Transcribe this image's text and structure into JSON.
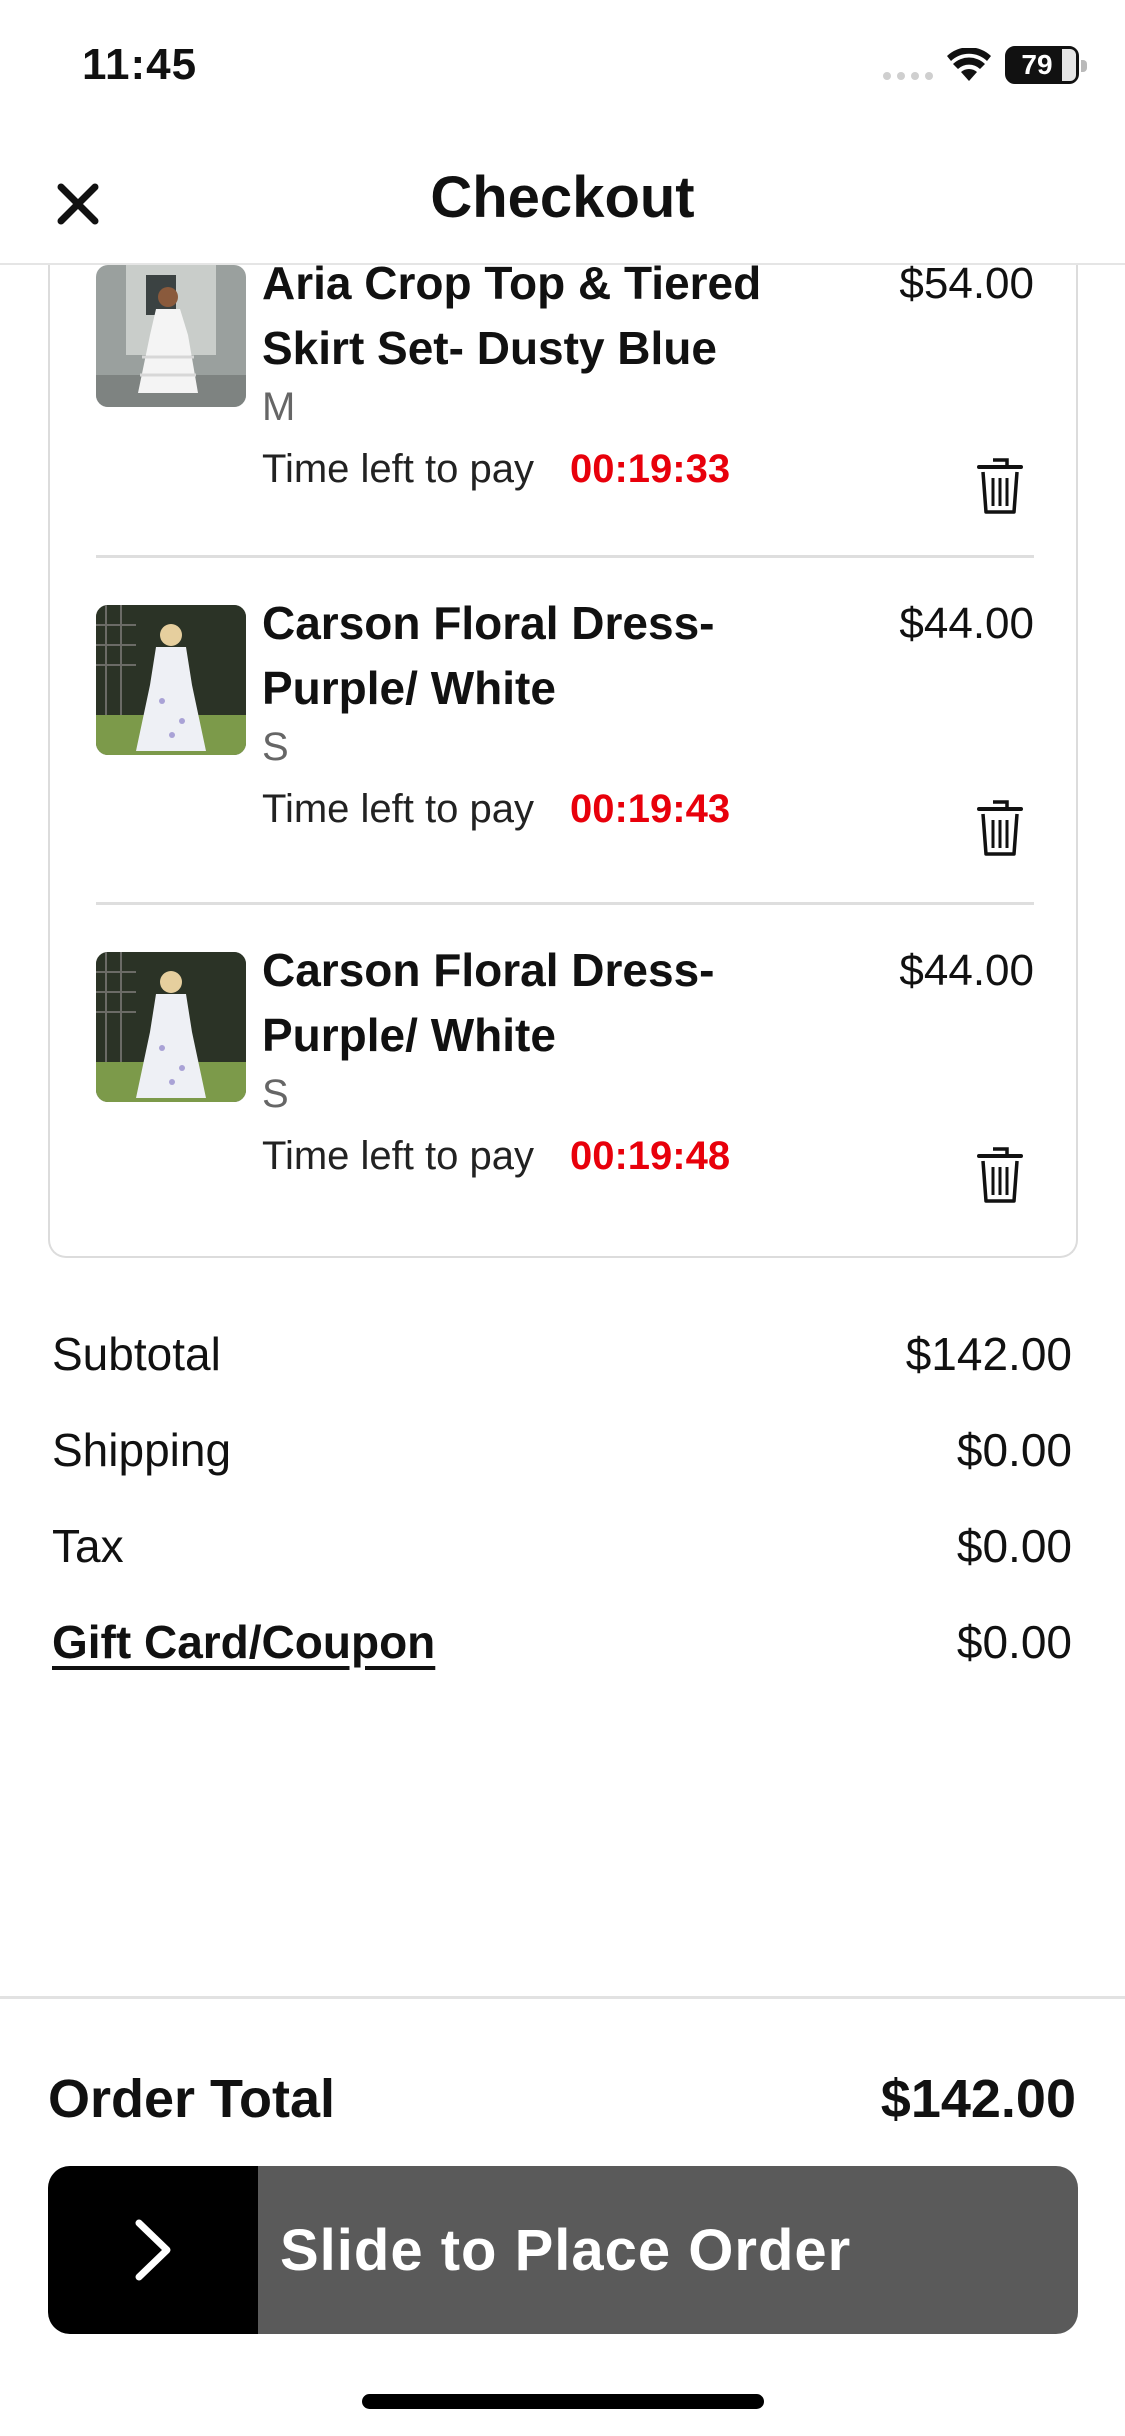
{
  "status_bar": {
    "time": "11:45",
    "battery": "79"
  },
  "header": {
    "title": "Checkout"
  },
  "cart": {
    "items": [
      {
        "name": "Aria Crop Top & Tiered Skirt Set- Dusty Blue",
        "size": "M",
        "timer_label": "Time left to pay",
        "timer": "00:19:33",
        "price": "$54.00"
      },
      {
        "name": "Carson Floral Dress- Purple/ White",
        "size": "S",
        "timer_label": "Time left to pay",
        "timer": "00:19:43",
        "price": "$44.00"
      },
      {
        "name": "Carson Floral Dress- Purple/ White",
        "size": "S",
        "timer_label": "Time left to pay",
        "timer": "00:19:48",
        "price": "$44.00"
      }
    ]
  },
  "summary": {
    "subtotal_label": "Subtotal",
    "subtotal": "$142.00",
    "shipping_label": "Shipping",
    "shipping": "$0.00",
    "tax_label": "Tax",
    "tax": "$0.00",
    "coupon_label": "Gift Card/Coupon",
    "coupon": "$0.00"
  },
  "order_total": {
    "label": "Order Total",
    "value": "$142.00"
  },
  "slider": {
    "label": "Slide to Place Order"
  },
  "colors": {
    "timer": "#e8000b",
    "slider_bg": "#5a5a5a",
    "slider_handle": "#000000"
  }
}
